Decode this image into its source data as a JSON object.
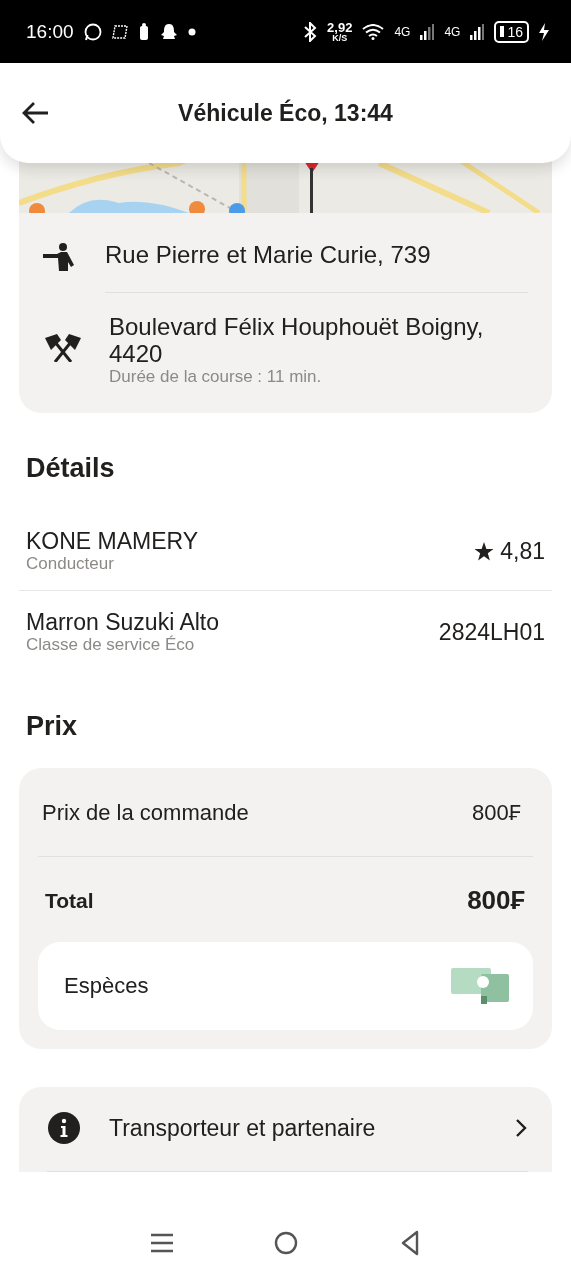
{
  "status_bar": {
    "time": "16:00",
    "speed_value": "2,92",
    "speed_unit": "K/S",
    "network_1": "4G",
    "network_2": "4G",
    "battery": "16"
  },
  "header": {
    "title": "Véhicule Éco, 13:44"
  },
  "route": [
    {
      "kind": "pickup",
      "address": "Rue Pierre et Marie Curie, 739"
    },
    {
      "kind": "destination",
      "address": "Boulevard Félix Houphouët Boigny, 4420",
      "note": "Durée de la course : 11 min."
    }
  ],
  "details": {
    "title": "Détails",
    "rows": [
      {
        "kind": "rating",
        "primary": "KONE MAMERY",
        "secondary": "Conducteur",
        "value": "4,81"
      },
      {
        "kind": "plate",
        "primary": "Marron Suzuki Alto",
        "secondary": "Classe de service Éco",
        "value": "2824LH01"
      }
    ]
  },
  "price": {
    "title": "Prix",
    "lines": [
      {
        "kind": "line",
        "label": "Prix de la commande",
        "value": "800₣"
      },
      {
        "kind": "total",
        "label": "Total",
        "value": "800₣"
      }
    ],
    "payment": "Espèces"
  },
  "links": [
    {
      "label": "Transporteur et partenaire"
    }
  ]
}
